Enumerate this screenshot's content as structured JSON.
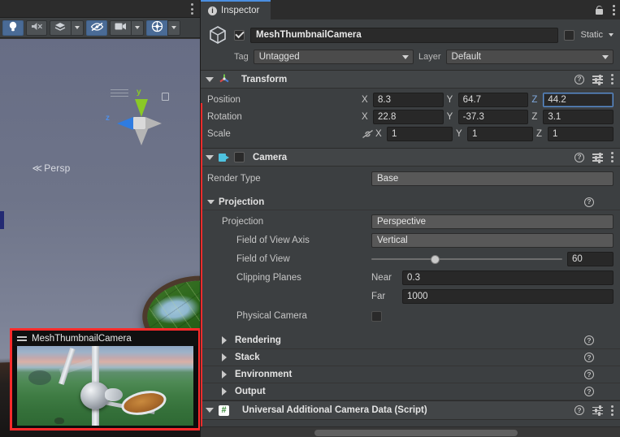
{
  "scene_view": {
    "kebab_icon": "kebab-menu-icon",
    "toolbar": [
      {
        "name": "lighting-toggle",
        "icon": "lightbulb-icon",
        "active": true,
        "has_dropdown": false
      },
      {
        "name": "audio-toggle",
        "icon": "audio-mute-icon",
        "active": false,
        "has_dropdown": false
      },
      {
        "name": "effects-toggle",
        "icon": "fx-icon",
        "active": false,
        "has_dropdown": true
      },
      {
        "name": "scene-visibility-toggle",
        "icon": "eye-hidden-icon",
        "active": true,
        "has_dropdown": false
      },
      {
        "name": "camera-settings",
        "icon": "camera-icon",
        "active": false,
        "has_dropdown": true
      },
      {
        "name": "gizmos-toggle",
        "icon": "gizmo-globe-icon",
        "active": true,
        "has_dropdown": true
      }
    ],
    "gizmo": {
      "y_axis_label": "y",
      "z_axis_label": "z",
      "perspective_label": "Persp",
      "perspective_arrow": "≪"
    },
    "camera_preview": {
      "title": "MeshThumbnailCamera",
      "grip_icon": "drag-grip-icon",
      "highlight_color": "#ff2b2b"
    }
  },
  "inspector": {
    "tab": {
      "label": "Inspector",
      "icon": "info-icon"
    },
    "lock_icon": "lock-open-icon",
    "kebab_icon": "kebab-menu-icon",
    "accent_color": "#4a8ee0",
    "object_header": {
      "prefab_icon": "cube-icon",
      "enabled": true,
      "name": "MeshThumbnailCamera",
      "static_checked": false,
      "static_label": "Static",
      "static_dropdown_icon": "chevron-down-icon",
      "tag_label": "Tag",
      "tag_value": "Untagged",
      "layer_label": "Layer",
      "layer_value": "Default"
    },
    "transform": {
      "title": "Transform",
      "icon": "transform-axis-icon",
      "expanded": true,
      "help_icon": "help-icon",
      "preset_icon": "preset-sliders-icon",
      "kebab_icon": "kebab-menu-icon",
      "rows": [
        {
          "label": "Position",
          "axes": [
            {
              "axis": "X",
              "value": "8.3",
              "focused": false
            },
            {
              "axis": "Y",
              "value": "64.7",
              "focused": false
            },
            {
              "axis": "Z",
              "value": "44.2",
              "focused": true
            }
          ]
        },
        {
          "label": "Rotation",
          "axes": [
            {
              "axis": "X",
              "value": "22.8",
              "focused": false
            },
            {
              "axis": "Y",
              "value": "-37.3",
              "focused": false
            },
            {
              "axis": "Z",
              "value": "3.1",
              "focused": false
            }
          ]
        },
        {
          "label": "Scale",
          "link_icon": "scale-link-off-icon",
          "axes": [
            {
              "axis": "X",
              "value": "1",
              "focused": false
            },
            {
              "axis": "Y",
              "value": "1",
              "focused": false
            },
            {
              "axis": "Z",
              "value": "1",
              "focused": false
            }
          ]
        }
      ]
    },
    "camera": {
      "title": "Camera",
      "icon": "camera-icon",
      "enabled": false,
      "expanded": true,
      "help_icon": "help-icon",
      "preset_icon": "preset-sliders-icon",
      "kebab_icon": "kebab-menu-icon",
      "render_type_label": "Render Type",
      "render_type_value": "Base",
      "projection_section_label": "Projection",
      "projection_label": "Projection",
      "projection_value": "Perspective",
      "fov_axis_label": "Field of View Axis",
      "fov_axis_value": "Vertical",
      "fov_label": "Field of View",
      "fov_value": "60",
      "fov_slider_percent": 33,
      "clipping_planes_label": "Clipping Planes",
      "near_label": "Near",
      "near_value": "0.3",
      "far_label": "Far",
      "far_value": "1000",
      "physical_camera_label": "Physical Camera",
      "physical_camera_checked": false,
      "foldouts": [
        {
          "label": "Rendering",
          "expanded": false,
          "help_icon": "help-icon"
        },
        {
          "label": "Stack",
          "expanded": false,
          "help_icon": "help-icon"
        },
        {
          "label": "Environment",
          "expanded": false,
          "help_icon": "help-icon"
        },
        {
          "label": "Output",
          "expanded": false,
          "help_icon": "help-icon"
        }
      ]
    },
    "script_component": {
      "title": "Universal Additional Camera Data (Script)",
      "icon": "script-icon",
      "expanded": true,
      "help_icon": "help-icon",
      "preset_icon": "preset-sliders-icon",
      "kebab_icon": "kebab-menu-icon"
    },
    "horizontal_scrollbar": "h-scrollbar"
  }
}
